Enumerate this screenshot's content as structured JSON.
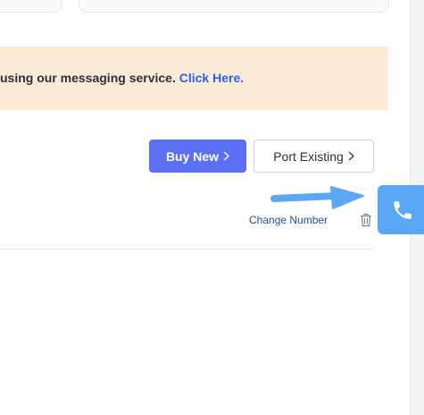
{
  "banner": {
    "text": "using our messaging service. ",
    "link": "Click Here."
  },
  "actions": {
    "buy_new": "Buy New",
    "port_existing": "Port Existing"
  },
  "number_row": {
    "change_number": "Change Number"
  },
  "icons": {
    "buy_new": "chevron-right-icon",
    "port_existing": "chevron-right-icon",
    "delete": "trash-icon",
    "phone_widget": "phone-icon",
    "annotation": "arrow-right-icon"
  },
  "colors": {
    "banner_bg": "#fdebd8",
    "link": "#2563eb",
    "primary_button": "#5b6ff3",
    "phone_widget": "#5aa8f5",
    "annotation_arrow": "#5aa8f5"
  }
}
